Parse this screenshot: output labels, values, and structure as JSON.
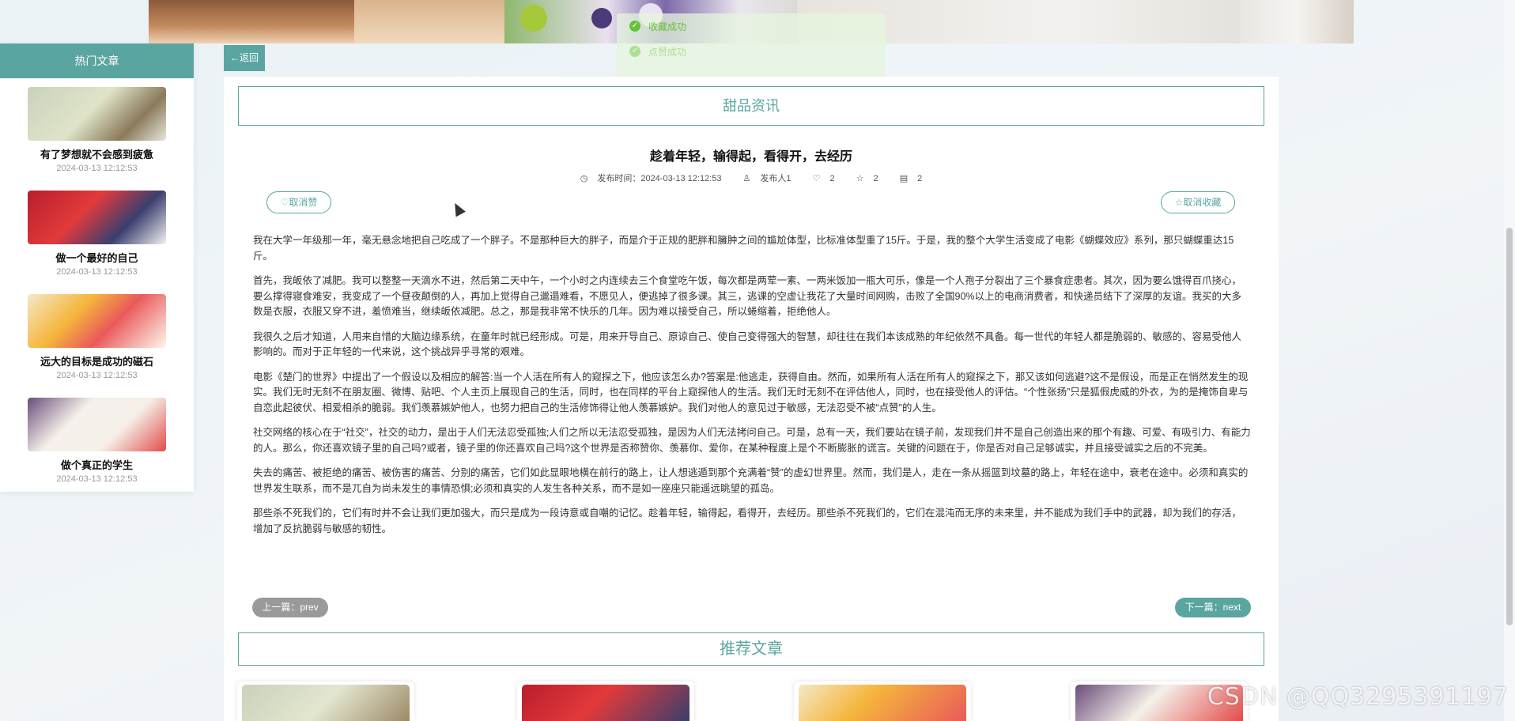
{
  "toasts": [
    "收藏成功",
    "点赞成功"
  ],
  "sidebar": {
    "heading": "热门文章",
    "items": [
      {
        "title": "有了梦想就不会感到疲惫",
        "time": "2024-03-13 12:12:53"
      },
      {
        "title": "做一个最好的自己",
        "time": "2024-03-13 12:12:53"
      },
      {
        "title": "远大的目标是成功的磁石",
        "time": "2024-03-13 12:12:53"
      },
      {
        "title": "做个真正的学生",
        "time": "2024-03-13 12:12:53"
      }
    ]
  },
  "back_label": "←返回",
  "section_title": "甜品资讯",
  "article": {
    "title": "趁着年轻，输得起，看得开，去经历",
    "meta": {
      "publish": "发布时间：2024-03-13 12:12:53",
      "author": "发布人1",
      "likes": "2",
      "favorites": "2",
      "comments": "2"
    },
    "unlike_label": "♡取消赞",
    "unfavorite_label": "☆取消收藏",
    "paragraphs": [
      "我在大学一年级那一年，毫无悬念地把自己吃成了一个胖子。不是那种巨大的胖子，而是介于正规的肥胖和臃肿之间的尴尬体型，比标准体型重了15斤。于是，我的整个大学生活变成了电影《蝴蝶效应》系列，那只蝴蝶重达15斤。",
      "首先，我皈依了减肥。我可以整整一天滴水不进，然后第二天中午，一个小时之内连续去三个食堂吃午饭，每次都是两荤一素、一两米饭加一瓶大可乐，像是一个人孢子分裂出了三个暴食症患者。其次，因为要么饿得百爪挠心，要么撑得寝食难安，我变成了一个昼夜颠倒的人，再加上觉得自己邋遢难看，不愿见人，便逃掉了很多课。其三，逃课的空虚让我花了大量时间网购，击败了全国90%以上的电商消费者，和快递员结下了深厚的友谊。我买的大多数是衣服，衣服又穿不进，羞愤难当，继续皈依减肥。总之，那是我非常不快乐的几年。因为难以接受自己，所以蜷缩着，拒绝他人。",
      "我很久之后才知道，人用来自惜的大脑边缘系统，在童年时就已经形成。可是，用来开导自己、原谅自己、使自己变得强大的智慧，却往往在我们本该成熟的年纪依然不具备。每一世代的年轻人都是脆弱的、敏感的、容易受他人影响的。而对于正年轻的一代来说，这个挑战异乎寻常的艰难。",
      "电影《楚门的世界》中提出了一个假设以及相应的解答:当一个人活在所有人的窥探之下，他应该怎么办?答案是:他逃走，获得自由。然而，如果所有人活在所有人的窥探之下，那又该如何逃避?这不是假设，而是正在悄然发生的现实。我们无时无刻不在朋友圈、微博、贴吧、个人主页上展现自己的生活，同时，也在同样的平台上窥探他人的生活。我们无时无刻不在评估他人，同时，也在接受他人的评估。“个性张扬”只是狐假虎威的外衣，为的是掩饰自卑与自恋此起彼伏、相爱相杀的脆弱。我们羡慕嫉妒他人，也努力把自己的生活修饰得让他人羡慕嫉妒。我们对他人的意见过于敏感，无法忍受不被“点赞”的人生。",
      "社交网络的核心在于“社交”，社交的动力，是出于人们无法忍受孤独;人们之所以无法忍受孤独，是因为人们无法拷问自己。可是，总有一天，我们要站在镜子前，发现我们并不是自己创造出来的那个有趣、可爱、有吸引力、有能力的人。那么，你还喜欢镜子里的自己吗?或者，镜子里的你还喜欢自己吗?这个世界是否称赞你、羡慕你、爱你，在某种程度上是个不断膨胀的谎言。关键的问题在于，你是否对自己足够诚实，并且接受诚实之后的不完美。",
      "失去的痛苦、被拒绝的痛苦、被伤害的痛苦、分别的痛苦，它们如此显眼地横在前行的路上，让人想逃遁到那个充满着“赞”的虚幻世界里。然而，我们是人，走在一条从摇篮到坟墓的路上，年轻在途中，衰老在途中。必须和真实的世界发生联系，而不是兀自为尚未发生的事情恐惧;必须和真实的人发生各种关系，而不是如一座座只能遥远眺望的孤岛。",
      "那些杀不死我们的，它们有时并不会让我们更加强大，而只是成为一段诗意或自嘲的记忆。趁着年轻，输得起，看得开，去经历。那些杀不死我们的，它们在混沌而无序的未来里，并不能成为我们手中的武器，却为我们的存活，增加了反抗脆弱与敏感的韧性。"
    ]
  },
  "prev_label": "上一篇：prev",
  "next_label": "下一篇：next",
  "recommend_title": "推荐文章",
  "watermark": "CSDN @QQ3295391197",
  "colors": {
    "accent": "#5aa5a0",
    "toast_green": "#67c23a",
    "prev_gray": "#9a9a9a"
  }
}
